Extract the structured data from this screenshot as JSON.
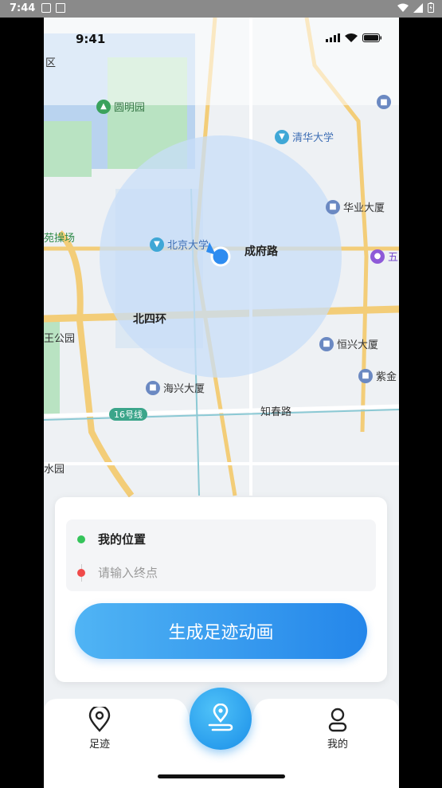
{
  "android_status": {
    "time": "7:44"
  },
  "ios_status": {
    "time": "9:41"
  },
  "map": {
    "labels": {
      "district": "区",
      "yuanmingyuan": "圆明园",
      "tsinghua": "清华大学",
      "huaye": "华业大厦",
      "square": "苑操场",
      "pku": "北京大学",
      "chengfu": "成府路",
      "five": "五",
      "beisihuan": "北四环",
      "park": "王公园",
      "hengxing": "恒兴大厦",
      "zijin": "紫金",
      "haixing": "海兴大厦",
      "line16": "16号线",
      "zhichun": "知春路",
      "water": "水园"
    },
    "colors": {
      "water": "#b9d3ef",
      "green": "#b9e3c2",
      "road_main": "#f3cd78",
      "road": "#ffffff",
      "accuracy": "#c8def8",
      "location": "#2e8cf0"
    }
  },
  "route": {
    "origin_label": "我的位置",
    "destination_placeholder": "请输入终点",
    "origin_color": "#35c45a",
    "destination_color": "#f04a4a",
    "generate_button": "生成足迹动画"
  },
  "tabbar": {
    "left_label": "足迹",
    "left_icon": "location-pin-icon",
    "center_icon": "route-pin-icon",
    "right_label": "我的",
    "right_icon": "person-icon"
  }
}
